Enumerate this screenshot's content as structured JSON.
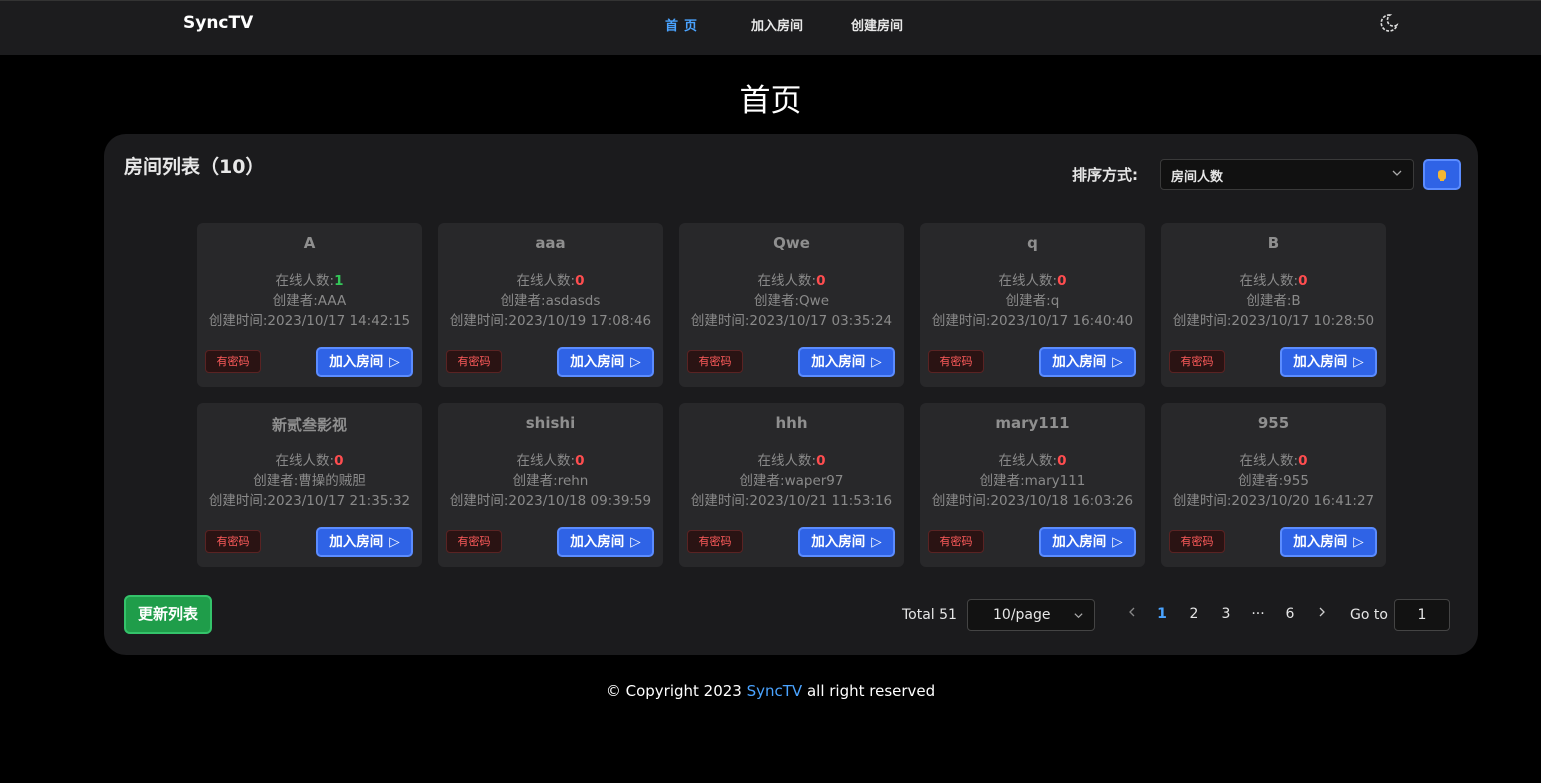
{
  "header": {
    "brand": "SyncTV",
    "nav": [
      {
        "label": "首页",
        "active": true
      },
      {
        "label": "加入房间",
        "active": false
      },
      {
        "label": "创建房间",
        "active": false
      }
    ],
    "theme_icon": "moon-icon"
  },
  "page_title": "首页",
  "room_list": {
    "title": "房间列表（10）",
    "sort_label": "排序方式:",
    "sort_value": "房间人数",
    "order_icon": "hand-icon",
    "online_label": "在线人数:",
    "creator_label": "创建者:",
    "created_label": "创建时间:",
    "password_tag": "有密码",
    "join_label": "加入房间",
    "rooms": [
      {
        "name": "A",
        "online": "1",
        "creator": "AAA",
        "created": "2023/10/17 14:42:15"
      },
      {
        "name": "aaa",
        "online": "0",
        "creator": "asdasds",
        "created": "2023/10/19 17:08:46"
      },
      {
        "name": "Qwe",
        "online": "0",
        "creator": "Qwe",
        "created": "2023/10/17 03:35:24"
      },
      {
        "name": "q",
        "online": "0",
        "creator": "q",
        "created": "2023/10/17 16:40:40"
      },
      {
        "name": "B",
        "online": "0",
        "creator": "B",
        "created": "2023/10/17 10:28:50"
      },
      {
        "name": "新贰叁影视",
        "online": "0",
        "creator": "曹操的贼胆",
        "created": "2023/10/17 21:35:32"
      },
      {
        "name": "shishi",
        "online": "0",
        "creator": "rehn",
        "created": "2023/10/18 09:39:59"
      },
      {
        "name": "hhh",
        "online": "0",
        "creator": "waper97",
        "created": "2023/10/21 11:53:16"
      },
      {
        "name": "mary111",
        "online": "0",
        "creator": "mary111",
        "created": "2023/10/18 16:03:26"
      },
      {
        "name": "955",
        "online": "0",
        "creator": "955",
        "created": "2023/10/20 16:41:27"
      }
    ],
    "refresh_label": "更新列表"
  },
  "pagination": {
    "total": "Total 51",
    "page_size": "10/page",
    "pages": [
      "1",
      "2",
      "3",
      "···",
      "6"
    ],
    "current": "1",
    "goto_label": "Go to",
    "goto_value": "1"
  },
  "footer": {
    "prefix": "© Copyright 2023 ",
    "brand": "SyncTV",
    "suffix": " all right reserved"
  },
  "colors": {
    "accent": "#4aa3ff",
    "primary_button": "#2f63e6",
    "success_button": "#1f9d4a",
    "danger": "#ff4d4f",
    "online": "#34c759"
  }
}
